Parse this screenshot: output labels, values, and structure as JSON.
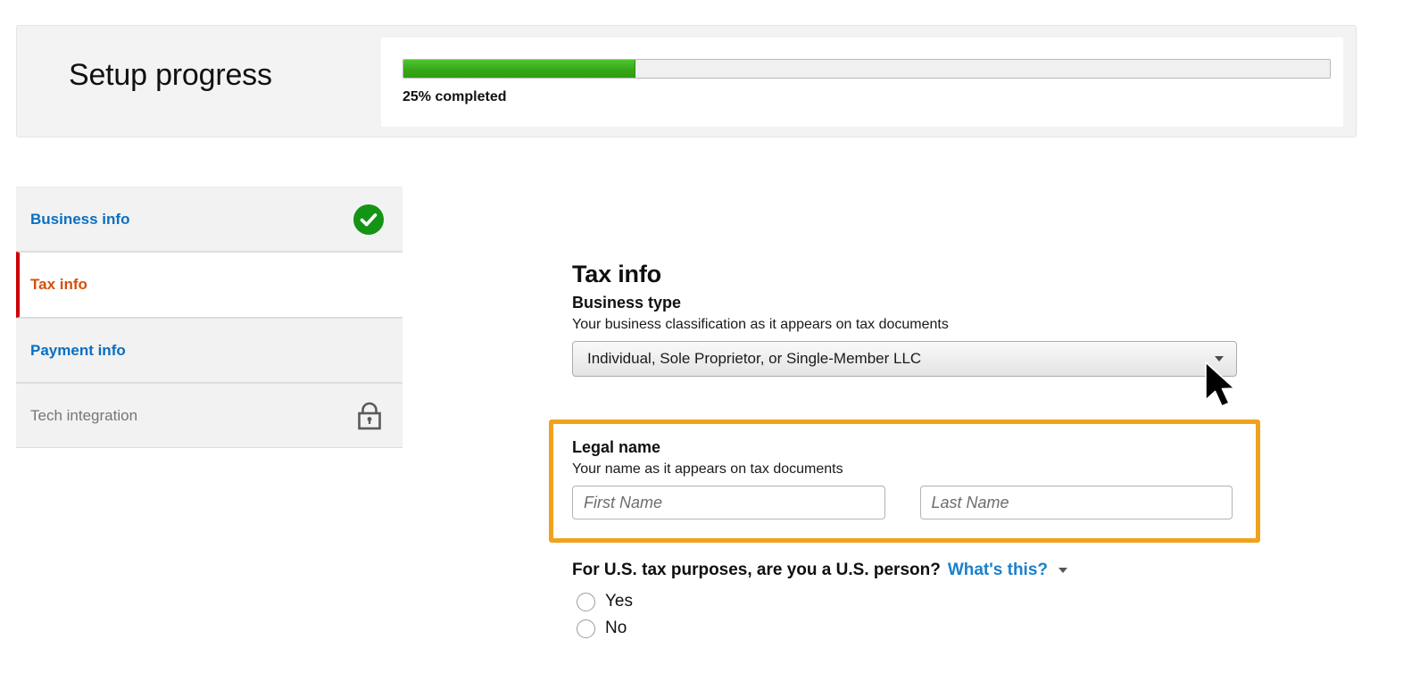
{
  "header": {
    "title": "Setup progress",
    "progress_percent": 25,
    "progress_label": "25% completed",
    "progress_color": "#36a818"
  },
  "sidebar": {
    "items": [
      {
        "label": "Business info",
        "state": "complete",
        "icon": "check-circle-icon",
        "color": "#0a6fc2"
      },
      {
        "label": "Tax info",
        "state": "current",
        "icon": "",
        "color": "#d4500a"
      },
      {
        "label": "Payment info",
        "state": "pending",
        "icon": "",
        "color": "#0a6fc2"
      },
      {
        "label": "Tech integration",
        "state": "locked",
        "icon": "lock-icon",
        "color": "#767676"
      }
    ]
  },
  "form": {
    "title": "Tax info",
    "business_type": {
      "label": "Business type",
      "help": "Your business classification as it appears on tax documents",
      "selected": "Individual, Sole Proprietor, or Single-Member LLC"
    },
    "legal_name": {
      "label": "Legal name",
      "help": "Your name as it appears on tax documents",
      "first_name_value": "",
      "first_name_placeholder": "First Name",
      "last_name_value": "",
      "last_name_placeholder": "Last Name",
      "highlight_color": "#f0a21c"
    },
    "us_person": {
      "question": "For U.S. tax purposes, are you a U.S. person?",
      "help_link": "What's this?",
      "options": [
        {
          "label": "Yes",
          "selected": false
        },
        {
          "label": "No",
          "selected": false
        }
      ]
    }
  }
}
